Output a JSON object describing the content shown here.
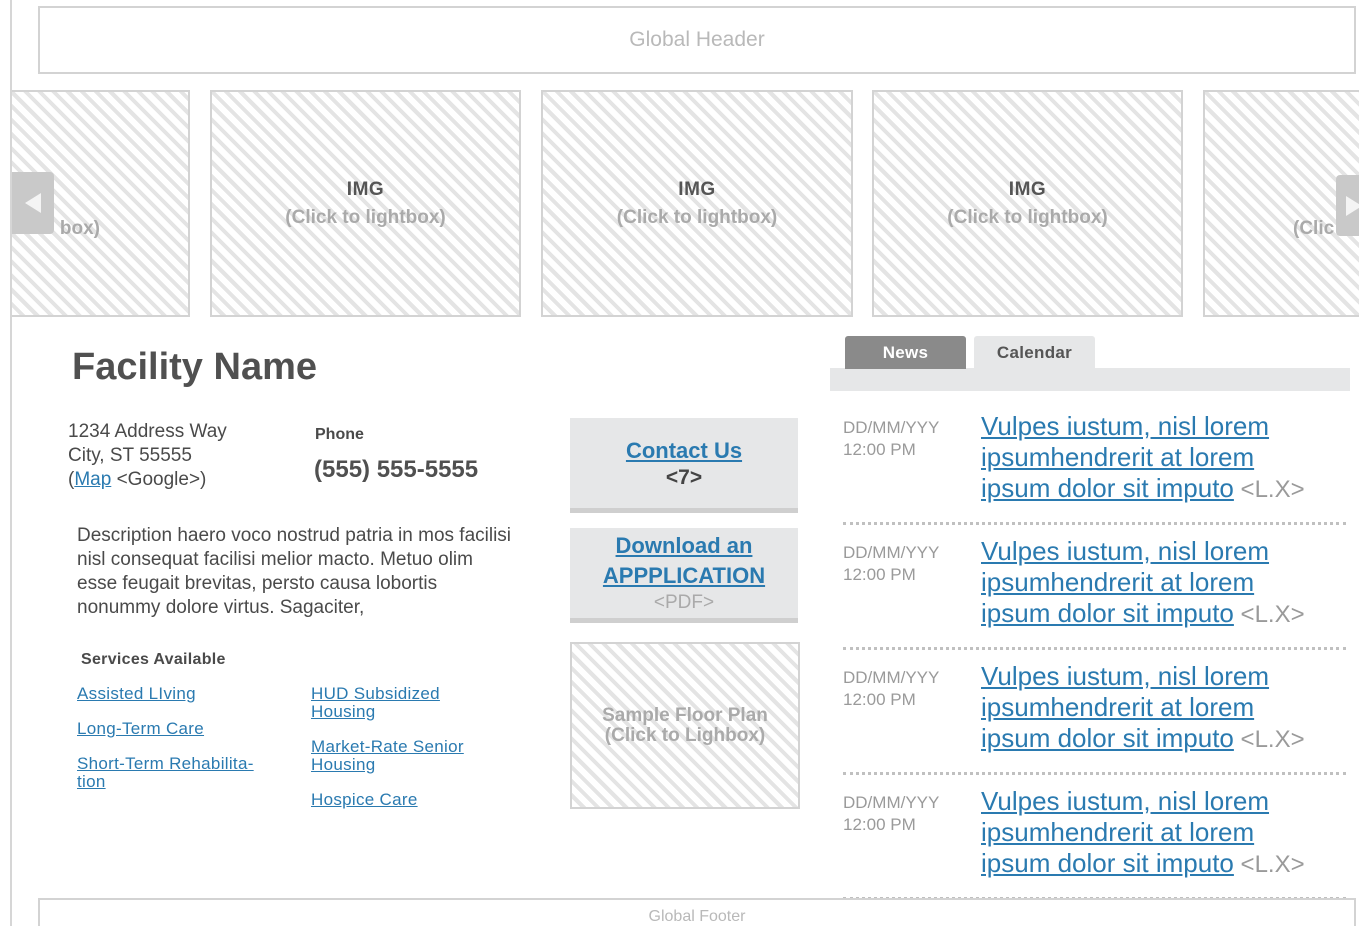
{
  "header": {
    "label": "Global Header"
  },
  "carousel": {
    "partial_left_sub": "box)",
    "slides": [
      {
        "label": "IMG",
        "sub": "(Click to lightbox)"
      },
      {
        "label": "IMG",
        "sub": "(Click to lightbox)"
      },
      {
        "label": "IMG",
        "sub": "(Click to lightbox)"
      }
    ],
    "partial_right_sub": "(Clic"
  },
  "facility": {
    "name": "Facility Name",
    "address_line1": "1234 Address Way",
    "address_line2": "City, ST 55555",
    "map_open": "(",
    "map_link": "Map",
    "map_note": " <Google>)",
    "phone_label": "Phone",
    "phone": "(555) 555-5555",
    "description": "Description haero voco nostrud patria in mos facilisi nisl consequat facilisi melior macto. Metuo olim esse feugait brevitas, persto causa lobortis nonummy dolore virtus. Sagaciter,"
  },
  "services": {
    "heading": "Services Available",
    "items": [
      "Assisted LIving",
      "Long-Term Care",
      "Short-Term Rehabilita-tion",
      "HUD Subsidized Housing",
      "Market-Rate Senior Housing",
      "Hospice Care"
    ]
  },
  "cta": {
    "contact_label": "Contact Us",
    "contact_sub": "<7>",
    "download_line1": "Download an",
    "download_line2": "APPPLICATION",
    "download_sub": "<PDF>"
  },
  "floorplan": {
    "line1": "Sample Floor Plan",
    "line2": "(Click to Lighbox)"
  },
  "tabs": {
    "news": "News",
    "calendar": "Calendar"
  },
  "news": [
    {
      "date": "DD/MM/YYY",
      "time": "12:00 PM",
      "line1": "Vulpes iustum, nisl lorem",
      "line2": "ipsumhendrerit at lorem",
      "line3": "ipsum dolor sit imputo",
      "suffix": " <L.X>"
    },
    {
      "date": "DD/MM/YYY",
      "time": "12:00 PM",
      "line1": "Vulpes iustum, nisl lorem",
      "line2": "ipsumhendrerit at lorem",
      "line3": "ipsum dolor sit imputo",
      "suffix": " <L.X>"
    },
    {
      "date": "DD/MM/YYY",
      "time": "12:00 PM",
      "line1": "Vulpes iustum, nisl lorem",
      "line2": "ipsumhendrerit at lorem",
      "line3": "ipsum dolor sit imputo",
      "suffix": " <L.X>"
    },
    {
      "date": "DD/MM/YYY",
      "time": "12:00 PM",
      "line1": "Vulpes iustum, nisl lorem",
      "line2": "ipsumhendrerit at lorem",
      "line3": "ipsum dolor sit imputo",
      "suffix": " <L.X>"
    }
  ],
  "footer": {
    "label": "Global Footer"
  },
  "colors": {
    "link": "#2a7ab0",
    "tab_active": "#8a8a8a",
    "panel_gray": "#e6e7e8",
    "placeholder_text": "#aaaaaa"
  },
  "icons": {
    "prev": "chevron-left-icon",
    "next": "chevron-right-icon"
  }
}
